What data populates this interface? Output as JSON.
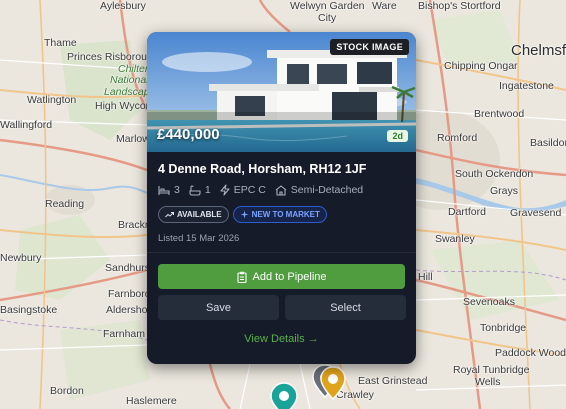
{
  "map": {
    "places": [
      {
        "name": "Aylesbury",
        "cls": ""
      },
      {
        "name": "Welwyn Garden",
        "cls": ""
      },
      {
        "name": "City",
        "cls": ""
      },
      {
        "name": "Ware",
        "cls": ""
      },
      {
        "name": "Bishop's Stortford",
        "cls": ""
      },
      {
        "name": "Thame",
        "cls": ""
      },
      {
        "name": "Princes Risborough",
        "cls": ""
      },
      {
        "name": "Chiltern",
        "cls": "park"
      },
      {
        "name": "National",
        "cls": "park"
      },
      {
        "name": "Landscape",
        "cls": "park"
      },
      {
        "name": "Watlington",
        "cls": ""
      },
      {
        "name": "High Wycombe",
        "cls": ""
      },
      {
        "name": "Chelmsford",
        "cls": "big"
      },
      {
        "name": "Chipping Ongar",
        "cls": ""
      },
      {
        "name": "Ingatestone",
        "cls": ""
      },
      {
        "name": "Brentwood",
        "cls": ""
      },
      {
        "name": "Wallingford",
        "cls": ""
      },
      {
        "name": "Marlow",
        "cls": ""
      },
      {
        "name": "Romford",
        "cls": ""
      },
      {
        "name": "Basildon",
        "cls": ""
      },
      {
        "name": "South Ockendon",
        "cls": ""
      },
      {
        "name": "Grays",
        "cls": ""
      },
      {
        "name": "Reading",
        "cls": ""
      },
      {
        "name": "Dartford",
        "cls": ""
      },
      {
        "name": "Gravesend",
        "cls": ""
      },
      {
        "name": "Bracknell",
        "cls": ""
      },
      {
        "name": "Swanley",
        "cls": ""
      },
      {
        "name": "Newbury",
        "cls": ""
      },
      {
        "name": "Sandhurst",
        "cls": ""
      },
      {
        "name": "Farnborough",
        "cls": ""
      },
      {
        "name": "Sevenoaks",
        "cls": ""
      },
      {
        "name": "Basingstoke",
        "cls": ""
      },
      {
        "name": "Aldershot",
        "cls": ""
      },
      {
        "name": "Farnham",
        "cls": ""
      },
      {
        "name": "Tonbridge",
        "cls": ""
      },
      {
        "name": "Royal Tunbridge",
        "cls": ""
      },
      {
        "name": "Wells",
        "cls": ""
      },
      {
        "name": "Paddock Wood",
        "cls": ""
      },
      {
        "name": "East Grinstead",
        "cls": ""
      },
      {
        "name": "Haslemere",
        "cls": ""
      },
      {
        "name": "Crawley",
        "cls": ""
      },
      {
        "name": "Hill",
        "cls": ""
      },
      {
        "name": "Bordon",
        "cls": ""
      }
    ]
  },
  "listing": {
    "stock_label": "STOCK IMAGE",
    "price": "£440,000",
    "age_badge": "2d",
    "address": "4 Denne Road, Horsham, RH12 1JF",
    "bedrooms": "3",
    "bathrooms": "1",
    "epc": "EPC C",
    "property_type": "Semi-Detached",
    "tags": [
      "AVAILABLE",
      "NEW TO MARKET"
    ],
    "listed": "Listed 15 Mar 2026"
  },
  "actions": {
    "pipeline_label": "Add to Pipeline",
    "save_label": "Save",
    "select_label": "Select",
    "view_details_label": "View Details →"
  },
  "colors": {
    "card_bg": "#151b29",
    "accent_green": "#4f9d3e",
    "tag_blue": "#2e5cc8",
    "pin_teal": "#1aa398",
    "pin_gold": "#e0a41c"
  }
}
